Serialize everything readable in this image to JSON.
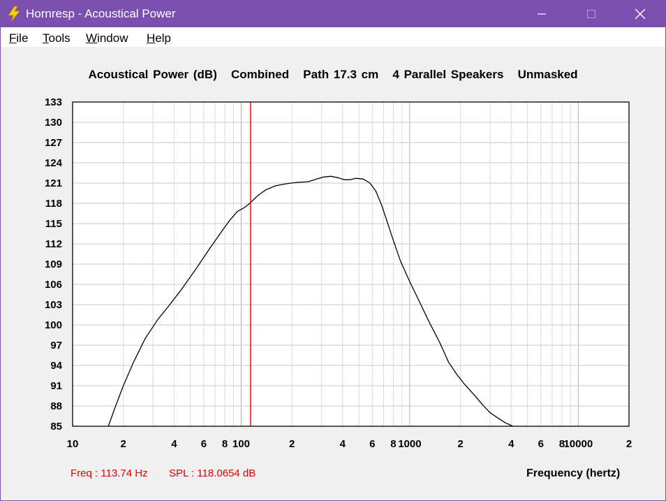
{
  "window": {
    "title": "Hornresp - Acoustical Power",
    "app_icon": "lightning-bolt-icon",
    "controls": {
      "minimize": "–",
      "maximize": "☐",
      "close": "✕"
    }
  },
  "menu": {
    "items": [
      "File",
      "Tools",
      "Window",
      "Help"
    ]
  },
  "chart_title": "Acoustical Power (dB)   Combined   Path 17.3 cm   4 Parallel Speakers   Unmasked",
  "status": {
    "freq": "Freq : 113.74 Hz",
    "spl": "SPL : 118.0654 dB"
  },
  "colors": {
    "titlebar": "#7a4fb0",
    "curve": "#000000",
    "cursor": "#e00000",
    "grid": "#c8c8c8"
  },
  "chart_data": {
    "type": "line",
    "title": "Acoustical Power (dB)   Combined   Path 17.3 cm   4 Parallel Speakers   Unmasked",
    "xlabel": "Frequency (hertz)",
    "ylabel": "",
    "xscale": "log",
    "xlim": [
      10,
      20000
    ],
    "ylim": [
      85,
      133
    ],
    "yticks": [
      85,
      88,
      91,
      94,
      97,
      100,
      103,
      106,
      109,
      112,
      115,
      118,
      121,
      124,
      127,
      130,
      133
    ],
    "xtick_labels": [
      {
        "x": 10,
        "label": "10"
      },
      {
        "x": 20,
        "label": "2"
      },
      {
        "x": 40,
        "label": "4"
      },
      {
        "x": 60,
        "label": "6"
      },
      {
        "x": 80,
        "label": "8"
      },
      {
        "x": 100,
        "label": "100"
      },
      {
        "x": 200,
        "label": "2"
      },
      {
        "x": 400,
        "label": "4"
      },
      {
        "x": 600,
        "label": "6"
      },
      {
        "x": 800,
        "label": "8"
      },
      {
        "x": 1000,
        "label": "1000"
      },
      {
        "x": 2000,
        "label": "2"
      },
      {
        "x": 4000,
        "label": "4"
      },
      {
        "x": 6000,
        "label": "6"
      },
      {
        "x": 8000,
        "label": "8"
      },
      {
        "x": 10000,
        "label": "10000"
      },
      {
        "x": 20000,
        "label": "2"
      }
    ],
    "grid": true,
    "cursor_x": 113.74,
    "series": [
      {
        "x": [
          16.3,
          18,
          20,
          23,
          27,
          32,
          38,
          45,
          54,
          65,
          75,
          85,
          95,
          105,
          113.74,
          125,
          140,
          160,
          185,
          215,
          250,
          280,
          310,
          340,
          375,
          410,
          440,
          480,
          530,
          580,
          630,
          680,
          730,
          800,
          880,
          1000,
          1150,
          1300,
          1500,
          1700,
          1900,
          2100,
          2400,
          2700,
          3000,
          3300,
          3700,
          4100
        ],
        "values": [
          85.0,
          88.0,
          91.0,
          94.5,
          98.0,
          100.8,
          103.1,
          105.5,
          108.3,
          111.3,
          113.5,
          115.4,
          116.8,
          117.4,
          118.1,
          119.1,
          120.0,
          120.6,
          120.9,
          121.1,
          121.2,
          121.6,
          121.9,
          122.0,
          121.8,
          121.5,
          121.5,
          121.7,
          121.6,
          121.0,
          119.8,
          117.8,
          115.5,
          112.5,
          109.5,
          106.4,
          103.3,
          100.5,
          97.5,
          94.5,
          92.7,
          91.3,
          89.7,
          88.2,
          87.0,
          86.3,
          85.5,
          85.0
        ]
      }
    ]
  }
}
